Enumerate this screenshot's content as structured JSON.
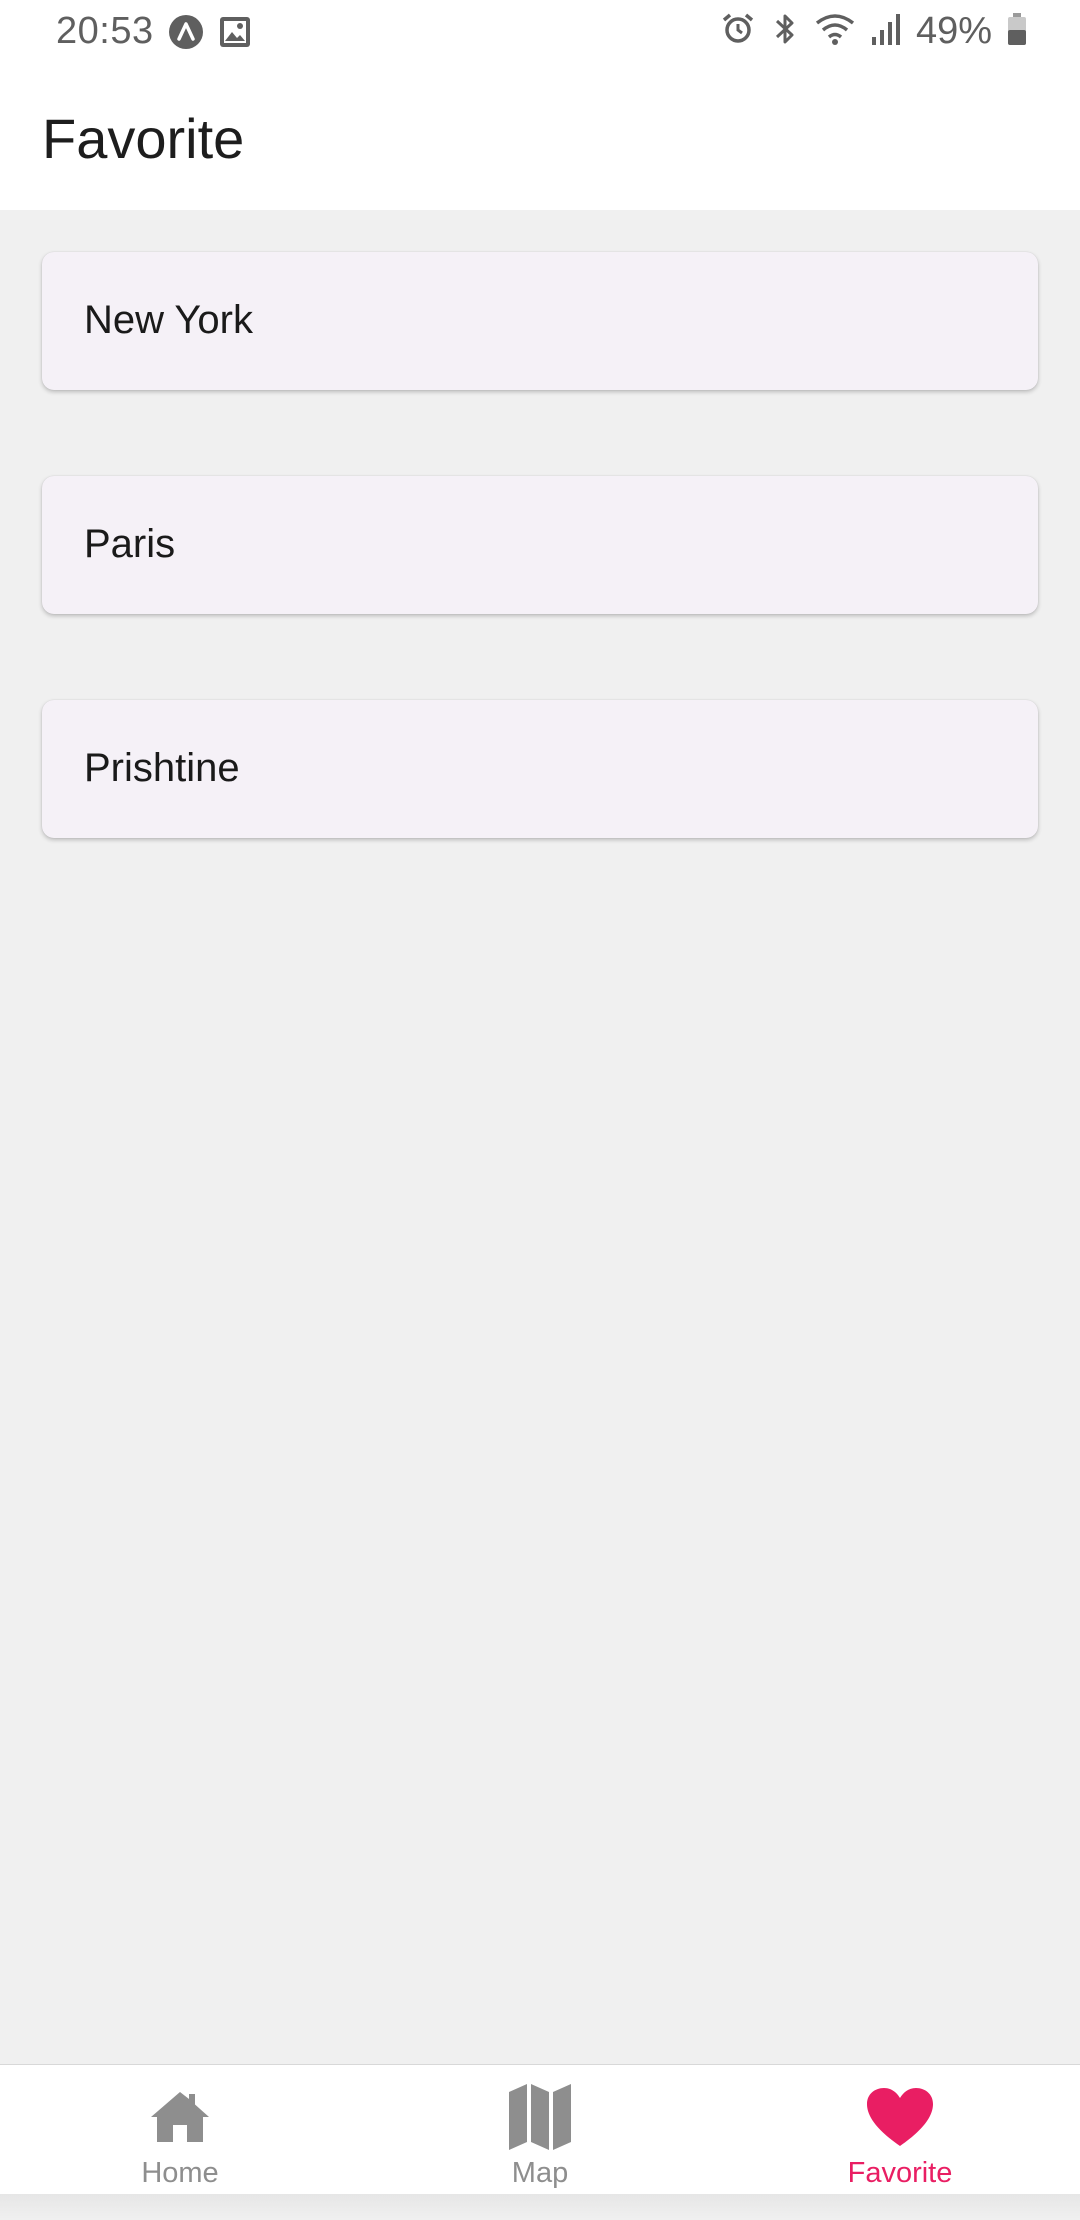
{
  "status_bar": {
    "time": "20:53",
    "battery": "49%",
    "left_icons": [
      "app-notification-icon",
      "image-icon"
    ],
    "right_icons": [
      "alarm-icon",
      "bluetooth-icon",
      "wifi-icon",
      "signal-icon",
      "battery-icon"
    ]
  },
  "header": {
    "title": "Favorite"
  },
  "favorites": [
    {
      "label": "New York"
    },
    {
      "label": "Paris"
    },
    {
      "label": "Prishtine"
    }
  ],
  "nav": {
    "items": [
      {
        "label": "Home",
        "icon": "home-icon",
        "active": false
      },
      {
        "label": "Map",
        "icon": "map-icon",
        "active": false
      },
      {
        "label": "Favorite",
        "icon": "heart-icon",
        "active": true
      }
    ]
  },
  "colors": {
    "accent": "#e91e63",
    "inactive": "#8e8e8e",
    "card_bg": "#f5f1f7",
    "screen_bg": "#f0f0f0"
  }
}
